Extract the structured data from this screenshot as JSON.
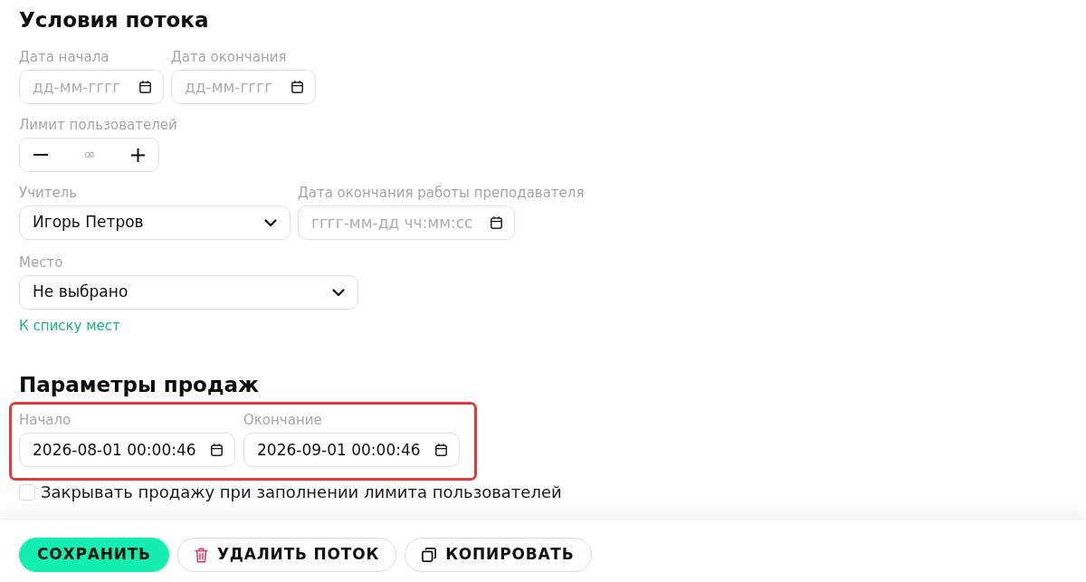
{
  "stream_conditions": {
    "title": "Условия потока",
    "start_date": {
      "label": "Дата начала",
      "placeholder": "дд-мм-гггг"
    },
    "end_date": {
      "label": "Дата окончания",
      "placeholder": "дд-мм-гггг"
    },
    "user_limit": {
      "label": "Лимит пользователей",
      "placeholder": "∞"
    },
    "teacher": {
      "label": "Учитель",
      "value": "Игорь Петров"
    },
    "teacher_end_date": {
      "label": "Дата окончания работы преподавателя",
      "placeholder": "гггг-мм-дд чч:мм:сс"
    },
    "place": {
      "label": "Место",
      "value": "Не выбрано"
    },
    "places_link": "К списку мест"
  },
  "sales": {
    "title": "Параметры продаж",
    "highlighted": true,
    "start": {
      "label": "Начало",
      "value": "2026-08-01 00:00:46"
    },
    "end": {
      "label": "Окончание",
      "value": "2026-09-01 00:00:46"
    },
    "close_on_limit": {
      "label": "Закрывать продажу при заполнении лимита пользователей",
      "checked": false
    }
  },
  "buttons": [
    {
      "kind": "save",
      "label": "СОХРАНИТЬ"
    },
    {
      "kind": "delete",
      "label": "УДАЛИТЬ ПОТОК"
    },
    {
      "kind": "copy",
      "label": "КОПИРОВАТЬ"
    }
  ]
}
